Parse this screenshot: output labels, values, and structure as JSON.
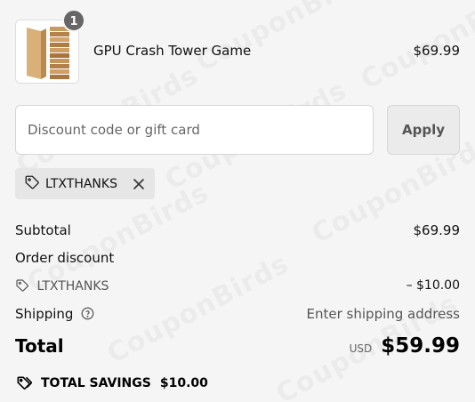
{
  "product": {
    "name": "GPU Crash Tower Game",
    "price": "$69.99",
    "quantity": "1"
  },
  "discount": {
    "placeholder": "Discount code or gift card",
    "value": "",
    "apply_label": "Apply",
    "applied_code": "LTXTHANKS"
  },
  "summary": {
    "subtotal_label": "Subtotal",
    "subtotal_value": "$69.99",
    "order_discount_label": "Order discount",
    "discount_code": "LTXTHANKS",
    "discount_value": "– $10.00",
    "shipping_label": "Shipping",
    "shipping_value": "Enter shipping address",
    "total_label": "Total",
    "currency": "USD",
    "total_value": "$59.99",
    "savings_label": "TOTAL SAVINGS",
    "savings_value": "$10.00"
  },
  "icons": {
    "chip_tag": "tag-icon",
    "chip_remove": "close-icon",
    "summary_tag": "tag-icon",
    "shipping_help": "help-circle-icon",
    "savings_tag": "tags-icon"
  },
  "watermark_text": "CouponBirds"
}
